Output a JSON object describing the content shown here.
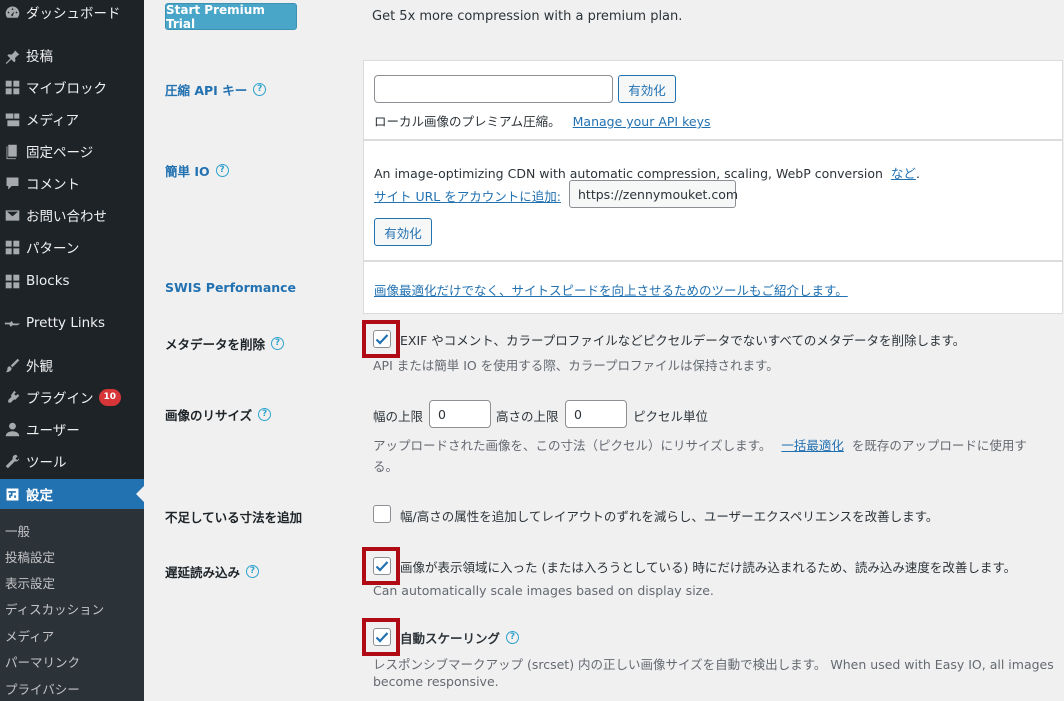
{
  "colors": {
    "sidebar_bg": "#1d2327",
    "accent": "#2271b1",
    "highlight_box": "#b00b14",
    "badge": "#d63638",
    "premium_button": "#4aa6c8"
  },
  "sidebar": {
    "items": [
      {
        "label": "ダッシュボード",
        "icon": "dashboard-icon"
      },
      {
        "label": "投稿",
        "icon": "pin-icon"
      },
      {
        "label": "マイブロック",
        "icon": "grid-icon"
      },
      {
        "label": "メディア",
        "icon": "media-icon"
      },
      {
        "label": "固定ページ",
        "icon": "page-icon"
      },
      {
        "label": "コメント",
        "icon": "comment-icon"
      },
      {
        "label": "お問い合わせ",
        "icon": "mail-icon"
      },
      {
        "label": "パターン",
        "icon": "grid-icon"
      },
      {
        "label": "Blocks",
        "icon": "grid-icon"
      },
      {
        "label": "Pretty Links",
        "icon": "pretty-links-icon"
      },
      {
        "label": "外観",
        "icon": "brush-icon"
      },
      {
        "label": "プラグイン",
        "icon": "plugin-icon",
        "badge": "10"
      },
      {
        "label": "ユーザー",
        "icon": "user-icon"
      },
      {
        "label": "ツール",
        "icon": "wrench-icon"
      },
      {
        "label": "設定",
        "icon": "settings-icon",
        "current": true
      }
    ],
    "submenu": [
      "一般",
      "投稿設定",
      "表示設定",
      "ディスカッション",
      "メディア",
      "パーマリンク",
      "プライバシー"
    ]
  },
  "premium": {
    "button_label": "Start Premium Trial",
    "note": "Get 5x more compression with a premium plan."
  },
  "api_key": {
    "label": "圧縮 API キー",
    "input_value": "",
    "activate_label": "有効化",
    "description": "ローカル画像のプレミアム圧縮。",
    "manage_link": "Manage your API keys"
  },
  "easy_io": {
    "label": "簡単 IO",
    "description": "An image-optimizing CDN with automatic compression, scaling, WebP conversion",
    "more_link": "など",
    "period": ".",
    "add_site_link": "サイト URL をアカウントに追加:",
    "site_url": "https://zennymouket.com",
    "activate_label": "有効化"
  },
  "swis": {
    "label": "SWIS Performance",
    "link": "画像最適化だけでなく、サイトスピードを向上させるためのツールもご紹介します。"
  },
  "metadata": {
    "label": "メタデータを削除",
    "checked": true,
    "text": "EXIF やコメント、カラープロファイルなどピクセルデータでないすべてのメタデータを削除します。",
    "note": "API または簡単 IO を使用する際、カラープロファイルは保持されます。"
  },
  "resize": {
    "label": "画像のリサイズ",
    "width_label": "幅の上限",
    "width_value": "0",
    "height_label": "高さの上限",
    "height_value": "0",
    "unit": "ピクセル単位",
    "desc_line1_a": "アップロードされた画像を、この寸法（ピクセル）にリサイズします。",
    "bulk_link": "一括最適化",
    "desc_line1_b": "を既存のアップロードに使用す",
    "desc_line2": "る。"
  },
  "add_dimensions": {
    "label": "不足している寸法を追加",
    "checked": false,
    "text": "幅/高さの属性を追加してレイアウトのずれを減らし、ユーザーエクスペリエンスを改善します。"
  },
  "lazy_load": {
    "label": "遅延読み込み",
    "checked": true,
    "text": "画像が表示領域に入った (または入ろうとしている) 時にだけ読み込まれるため、読み込み速度を改善します。",
    "note": "Can automatically scale images based on display size."
  },
  "auto_scaling": {
    "label": "自動スケーリング",
    "checked": true,
    "note_line1": "レスポンシブマークアップ (srcset) 内の正しい画像サイズを自動で検出します。 When used with Easy IO, all images",
    "note_line2": "become responsive."
  }
}
